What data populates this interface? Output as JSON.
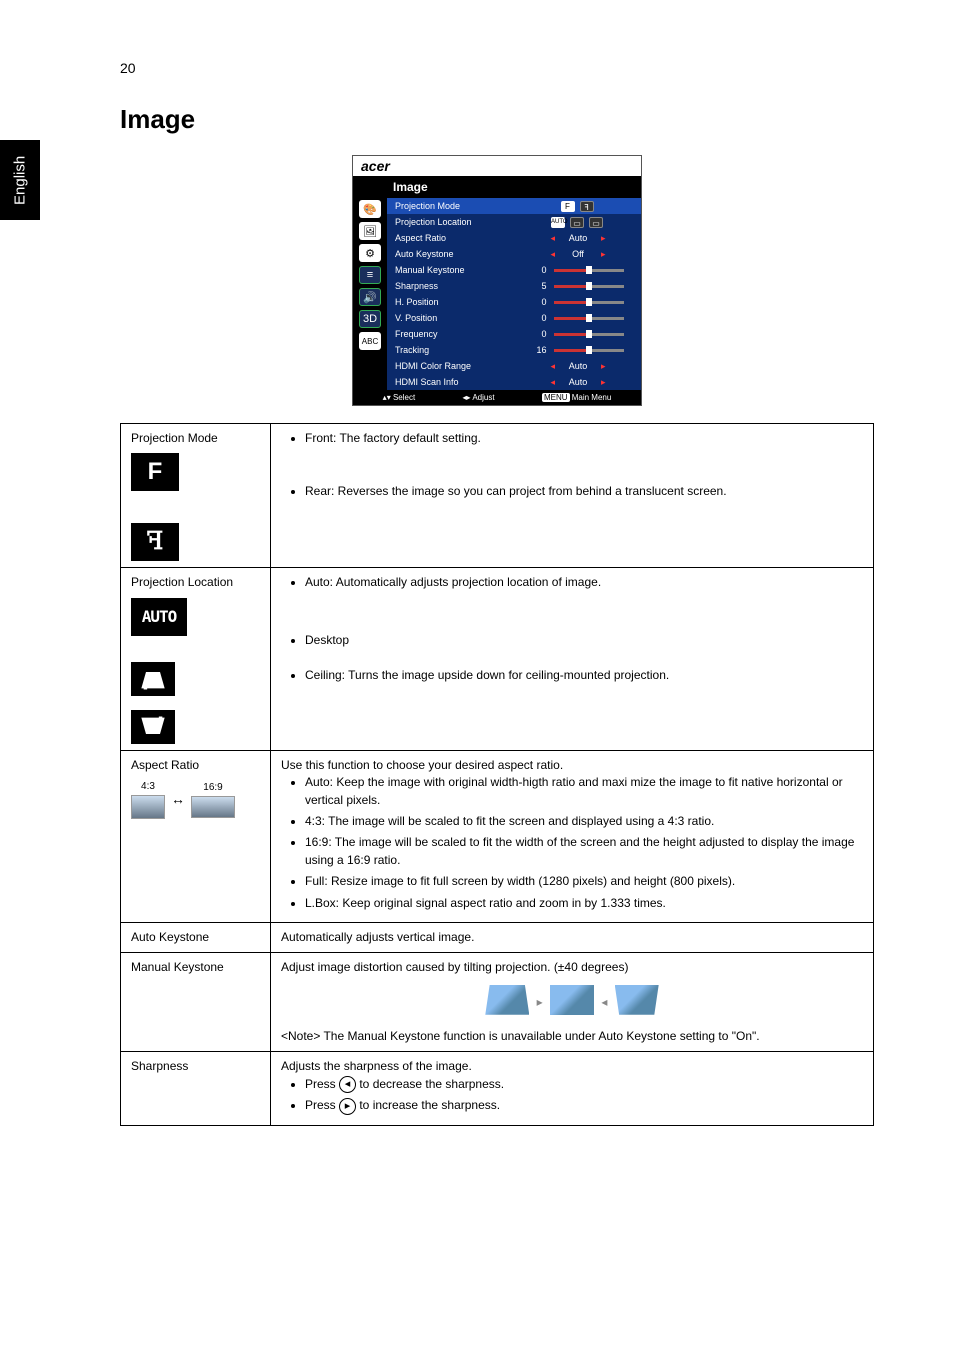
{
  "page_number": "20",
  "side_tab": "English",
  "section_title": "Image",
  "osd": {
    "brand": "acer",
    "title": "Image",
    "rows": [
      {
        "label": "Projection Mode",
        "type": "icons",
        "selected": true
      },
      {
        "label": "Projection Location",
        "type": "icons2"
      },
      {
        "label": "Aspect Ratio",
        "type": "arrows",
        "value": "Auto"
      },
      {
        "label": "Auto Keystone",
        "type": "arrows",
        "value": "Off"
      },
      {
        "label": "Manual Keystone",
        "type": "slider",
        "num": "0"
      },
      {
        "label": "Sharpness",
        "type": "slider",
        "num": "5"
      },
      {
        "label": "H. Position",
        "type": "slider",
        "num": "0"
      },
      {
        "label": "V. Position",
        "type": "slider",
        "num": "0"
      },
      {
        "label": "Frequency",
        "type": "slider",
        "num": "0"
      },
      {
        "label": "Tracking",
        "type": "slider",
        "num": "16"
      },
      {
        "label": "HDMI Color Range",
        "type": "arrows",
        "value": "Auto"
      },
      {
        "label": "HDMI Scan Info",
        "type": "arrows",
        "value": "Auto"
      }
    ],
    "footer": {
      "select": "Select",
      "adjust": "Adjust",
      "menu_badge": "MENU",
      "menu": "Main Menu"
    }
  },
  "table": {
    "projection_mode": {
      "label": "Projection Mode",
      "front": "Front: The factory default setting.",
      "rear": "Rear: Reverses the image so you can project from behind a translucent screen."
    },
    "projection_location": {
      "label": "Projection Location",
      "auto": "Auto: Automatically adjusts projection location of image.",
      "auto_icon": "AUTO",
      "desktop": "Desktop",
      "ceiling": "Ceiling: Turns the image upside down for ceiling-mounted projection."
    },
    "aspect_ratio": {
      "label": "Aspect Ratio",
      "r43": "4:3",
      "r169": "16:9",
      "intro": "Use this function to choose your desired aspect ratio.",
      "b1": "Auto: Keep the image with original width-higth ratio and maxi mize the image to fit native horizontal or vertical pixels.",
      "b2": "4:3: The image will be scaled to fit the screen and displayed using a 4:3 ratio.",
      "b3": "16:9: The image will be scaled to fit the width of the screen and the height adjusted to display the image using a 16:9 ratio.",
      "b4": "Full: Resize image to fit full screen by width (1280 pixels) and height (800 pixels).",
      "b5": "L.Box: Keep original signal aspect ratio and zoom in by 1.333 times."
    },
    "auto_keystone": {
      "label": "Auto Keystone",
      "text": "Automatically adjusts vertical image."
    },
    "manual_keystone": {
      "label": "Manual Keystone",
      "text": "Adjust image distortion caused by tilting projection. (±40 degrees)",
      "note": "<Note> The Manual Keystone function is unavailable under Auto Keystone setting to \"On\"."
    },
    "sharpness": {
      "label": "Sharpness",
      "text": "Adjusts the sharpness of the image.",
      "press": "Press ",
      "dec": " to decrease the sharpness.",
      "inc": " to increase the sharpness."
    }
  }
}
